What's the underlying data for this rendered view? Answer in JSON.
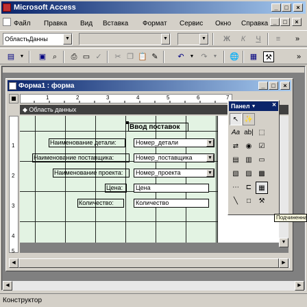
{
  "app": {
    "title": "Microsoft Access",
    "status": "Конструктор"
  },
  "menu": [
    {
      "label": "Файл"
    },
    {
      "label": "Правка"
    },
    {
      "label": "Вид"
    },
    {
      "label": "Вставка"
    },
    {
      "label": "Формат"
    },
    {
      "label": "Сервис"
    },
    {
      "label": "Окно"
    },
    {
      "label": "Справка"
    }
  ],
  "format_toolbar": {
    "object_select": "ОбластьДанны",
    "bold": "Ж",
    "italic": "К",
    "underline": "Ч"
  },
  "form_window": {
    "title": "Форма1 : форма",
    "section_header": "Область данных",
    "ruler_numbers": [
      "1",
      "2",
      "3",
      "4",
      "5",
      "6",
      "7"
    ],
    "vruler_numbers": [
      "1",
      "2",
      "3",
      "4",
      "5"
    ]
  },
  "form": {
    "title_label": "Ввод поставок",
    "rows": [
      {
        "label": "Наименование детали:",
        "value": "Номер_детали"
      },
      {
        "label": "Наименование поставщика:",
        "value": "Номер_поставщика"
      },
      {
        "label": "Наименование проекта:",
        "value": "Номер_проекта"
      },
      {
        "label": "Цена:",
        "value": "Цена"
      },
      {
        "label": "Количество:",
        "value": "Количество"
      }
    ]
  },
  "toolbox": {
    "title": "Панел",
    "tooltip": "Подчиненная форма/отчет"
  },
  "colors": {
    "title_start": "#0a246a",
    "title_end": "#a6caf0",
    "form_bg": "#e3f3e3",
    "grid": "#000000"
  }
}
